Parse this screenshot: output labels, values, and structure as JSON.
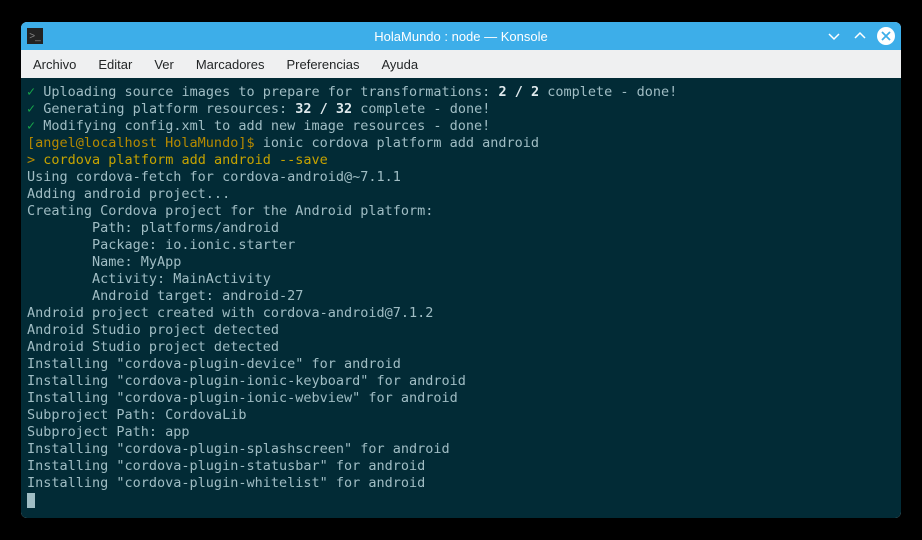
{
  "window": {
    "title": "HolaMundo : node — Konsole",
    "icon_glyph": ">_"
  },
  "menubar": [
    "Archivo",
    "Editar",
    "Ver",
    "Marcadores",
    "Preferencias",
    "Ayuda"
  ],
  "prompt": {
    "user_host": "[angel@localhost HolaMundo]$",
    "command": "ionic cordova platform add android"
  },
  "steps": [
    {
      "msg_pre": "Uploading source images to prepare for transformations: ",
      "bold": "2 / 2",
      "msg_post": " complete - done!"
    },
    {
      "msg_pre": "Generating platform resources: ",
      "bold": "32 / 32",
      "msg_post": " complete - done!"
    },
    {
      "msg_pre": "Modifying config.xml to add new image resources - done!",
      "bold": "",
      "msg_post": ""
    }
  ],
  "sub_cmd": {
    "gt": ">",
    "text": "cordova platform add android --save"
  },
  "output": [
    "Using cordova-fetch for cordova-android@~7.1.1",
    "Adding android project...",
    "Creating Cordova project for the Android platform:",
    "        Path: platforms/android",
    "        Package: io.ionic.starter",
    "        Name: MyApp",
    "        Activity: MainActivity",
    "        Android target: android-27",
    "Android project created with cordova-android@7.1.2",
    "Android Studio project detected",
    "Android Studio project detected",
    "Installing \"cordova-plugin-device\" for android",
    "Installing \"cordova-plugin-ionic-keyboard\" for android",
    "Installing \"cordova-plugin-ionic-webview\" for android",
    "Subproject Path: CordovaLib",
    "Subproject Path: app",
    "Installing \"cordova-plugin-splashscreen\" for android",
    "Installing \"cordova-plugin-statusbar\" for android",
    "Installing \"cordova-plugin-whitelist\" for android"
  ]
}
